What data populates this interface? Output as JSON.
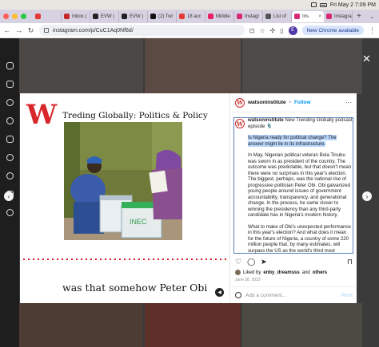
{
  "menubar": {
    "datetime": "Fri May 2  7:09 PM"
  },
  "tabs": [
    {
      "label": "",
      "color": "#e53935"
    },
    {
      "label": "Inbox (",
      "color": "#c62828"
    },
    {
      "label": "EVW |",
      "color": "#222222"
    },
    {
      "label": "EVW |",
      "color": "#222222"
    },
    {
      "label": "(2) Twi",
      "color": "#111111"
    },
    {
      "label": "18 acc",
      "color": "#e53935"
    },
    {
      "label": "Middle",
      "color": "#e91e63"
    },
    {
      "label": "Instagr",
      "color": "#d62976"
    },
    {
      "label": "List of",
      "color": "#555555"
    },
    {
      "label": "Ins",
      "color": "#d62976",
      "active": true
    },
    {
      "label": "Instagra",
      "color": "#d62976"
    }
  ],
  "toolbar": {
    "url": "instagram.com/p/CuC1Aq0Nf6d/",
    "profile_initial": "E",
    "chrome_available": "New Chrome available"
  },
  "post": {
    "brand_letter": "W",
    "title": "Treding Globally: Politics & Policy",
    "caption_overlay": "was that somehow Peter Obi",
    "account": "watsoninstitute",
    "dot": "•",
    "follow": "Follow",
    "caption_intro": "New Trending Globally podcast episode 🎙️",
    "caption_highlight": "Is Nigeria ready for political change? The answer might lie in its infrastructure.",
    "paragraph_1": "In May, Nigerian political veteran Bola Tinubu was sworn in as president of the country. The outcome was predictable, but that doesn't mean there were no surprises in this year's election. The biggest, perhaps, was the national rise of progressive politician Peter Obi. Obi galvanized young people around issues of government accountability, transparency, and generational change. In the process, he came closer to winning the presidency than any third-party candidate has in Nigeria's modern history.",
    "paragraph_2": "What to make of Obi's unexpected performance in this year's election? And what does it mean for the future of Nigeria, a country of some 220 million people that, by many estimates, will surpass the US as the world's third most populous country in the coming decades?",
    "liked_by_prefix": "Liked by",
    "liked_by_user": "enby_dreamsss",
    "liked_by_and": "and",
    "liked_by_others": "others",
    "date": "June 28, 2023",
    "comment_placeholder": "Add a comment...",
    "post_label": "Post"
  },
  "colors": {
    "brand_red": "#d8262b",
    "follow_blue": "#0095f6",
    "highlight": "#b7d4fb"
  }
}
